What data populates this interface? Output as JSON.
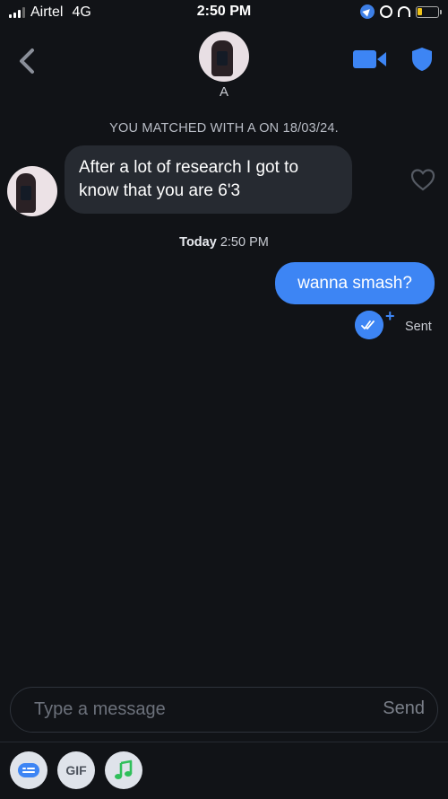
{
  "status_bar": {
    "carrier": "Airtel",
    "network": "4G",
    "time": "2:50 PM"
  },
  "header": {
    "contact_name": "A",
    "accent_color": "#3d85f4"
  },
  "chat": {
    "match_banner": "YOU MATCHED WITH A ON 18/03/24.",
    "received_message": {
      "line1": "After a lot of research I got to",
      "line2": "know that you are 6'3"
    },
    "timestamp_day": "Today",
    "timestamp_time": "2:50 PM",
    "sent_message": "wanna smash?",
    "sent_plus": "+",
    "sent_status": "Sent"
  },
  "composer": {
    "placeholder": "Type a message",
    "send_label": "Send"
  },
  "toolbar": {
    "gif_label": "GIF",
    "icons": [
      "sticker-icon",
      "gif-icon",
      "music-icon"
    ]
  }
}
